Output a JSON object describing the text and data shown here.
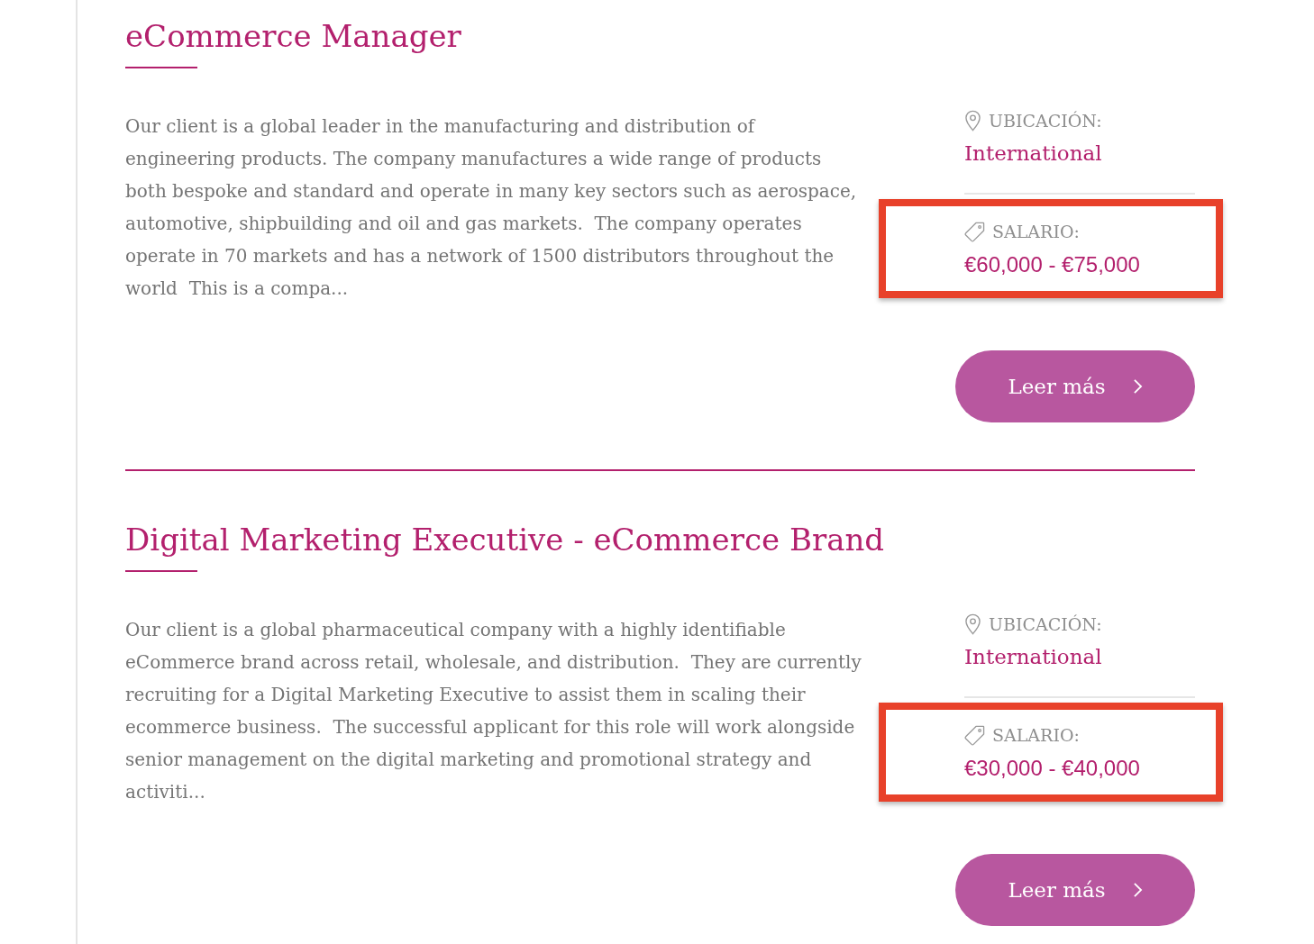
{
  "jobs": [
    {
      "title": "eCommerce Manager",
      "description": "Our client is a global leader in the manufacturing and distribution of engineering products. The company manufactures a wide range of products both bespoke and standard and operate in many key sectors such as aerospace, automotive, shipbuilding and oil and gas markets.  The company operates operate in 70 markets and has a network of 1500 distributors throughout the world  This is a compa...",
      "location": {
        "label": "UBICACIÓN:",
        "value": "International"
      },
      "salary": {
        "label": "SALARIO:",
        "value": "€60,000 - €75,000",
        "highlighted": true
      },
      "button": {
        "label": "Leer más"
      }
    },
    {
      "title": "Digital Marketing Executive - eCommerce Brand",
      "description": "Our client is a global pharmaceutical company with a highly identifiable eCommerce brand across retail, wholesale, and distribution.  They are currently recruiting for a Digital Marketing Executive to assist them in scaling their ecommerce business.  The successful applicant for this role will work alongside senior management on the digital marketing and promotional strategy and activiti...",
      "location": {
        "label": "UBICACIÓN:",
        "value": "International"
      },
      "salary": {
        "label": "SALARIO:",
        "value": "€30,000 - €40,000",
        "highlighted": true
      },
      "button": {
        "label": "Leer más"
      }
    }
  ]
}
